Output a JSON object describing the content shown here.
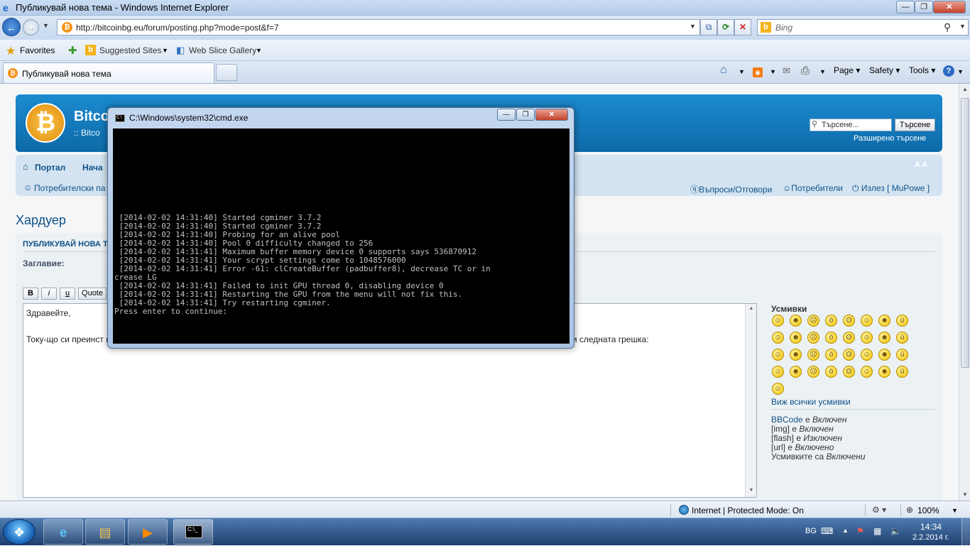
{
  "ie": {
    "title": "Публикувай нова тема - Windows Internet Explorer",
    "url": "http://bitcoinbg.eu/forum/posting.php?mode=post&f=7",
    "search_placeholder": "Bing",
    "favorites": "Favorites",
    "suggested_sites": "Suggested Sites",
    "web_slice": "Web Slice Gallery",
    "tab_title": "Публикувай нова тема",
    "page_menu": "Page",
    "safety_menu": "Safety",
    "tools_menu": "Tools"
  },
  "forum": {
    "site_name": "Bitco",
    "site_desc": ":: Bitco",
    "search_placeholder": "Търсене...",
    "search_button": "Търсене",
    "advanced_search": "Разширено търсене",
    "nav_portal": "Портал",
    "nav_index": "Нача",
    "font_size": "A A",
    "nav_ucp": "Потребителски па",
    "nav_faq": "Въпроси/Отговори",
    "nav_members": "Потребители",
    "nav_logout": "Излез [ MuPowe ]",
    "forum_title": "Хардуер",
    "post_heading": "ПУБЛИКУВАЙ НОВА Т",
    "subject_label": "Заглавие:",
    "bold": "B",
    "italic": "i",
    "underline": "u",
    "quote": "Quote",
    "message_line1": "Здравейте,",
    "message_line2": "Току-що си преинст                                                                                                                                             кам cgminer-a, който си беше настроен за вин7 и преди 3 часа копаех със същите настройки, сега го пускам и ми вади следната грешка:",
    "smilies_title": "Усмивки",
    "all_smilies": "Виж всички усмивки",
    "bbcode": {
      "name": "BBCode",
      "sep": " е ",
      "state": "Включен"
    },
    "img": {
      "name": "[img]",
      "sep": " е ",
      "state": "Включен"
    },
    "flash": {
      "name": "[flash]",
      "sep": " е ",
      "state": "Изключен"
    },
    "url_tag": {
      "name": "[url]",
      "sep": " е ",
      "state": "Включено"
    },
    "smilies_status": {
      "name": "Усмивките са",
      "sep": " ",
      "state": "Включени"
    }
  },
  "cmd": {
    "title": "C:\\Windows\\system32\\cmd.exe",
    "lines": [
      " [2014-02-02 14:31:40] Started cgminer 3.7.2",
      " [2014-02-02 14:31:40] Started cgminer 3.7.2",
      " [2014-02-02 14:31:40] Probing for an alive pool",
      " [2014-02-02 14:31:40] Pool 0 difficulty changed to 256",
      " [2014-02-02 14:31:41] Maximum buffer memory device 0 supports says 536870912",
      " [2014-02-02 14:31:41] Your scrypt settings come to 1048576000",
      " [2014-02-02 14:31:41] Error -61: clCreateBuffer (padbuffer8), decrease TC or in",
      "crease LG",
      " [2014-02-02 14:31:41] Failed to init GPU thread 0, disabling device 0",
      " [2014-02-02 14:31:41] Restarting the GPU from the menu will not fix this.",
      " [2014-02-02 14:31:41] Try restarting cgminer.",
      "Press enter to continue:"
    ]
  },
  "status": {
    "zone": "Internet | Protected Mode: On",
    "zoom": "100%"
  },
  "tray": {
    "lang": "BG",
    "time": "14:34",
    "date": "2.2.2014 г."
  },
  "icons": {
    "smilies": [
      "grin-smiley",
      "smile-smiley",
      "sad-smiley",
      "surprised-smiley",
      "eek-smiley",
      "cool-smiley",
      "laugh-smiley",
      "tongue-smiley",
      "mad-smiley",
      "razz-smiley",
      "red-smiley",
      "twisted-smiley",
      "evil-smiley",
      "rolleyes-smiley",
      "wink-smiley",
      "question-smiley",
      "arrow-smiley",
      "neutral-smiley",
      "mrgreen-smiley",
      "geek-smiley",
      "uber-smiley",
      "idea-smiley",
      "exclaim-smiley",
      "shock-smiley",
      "cry-smiley",
      "confused-smiley",
      "doh-smiley",
      "silent-smiley",
      "lol-smiley",
      "think-smiley",
      "violin-smiley",
      "whistle-smiley",
      "bitcoin-smiley"
    ]
  }
}
